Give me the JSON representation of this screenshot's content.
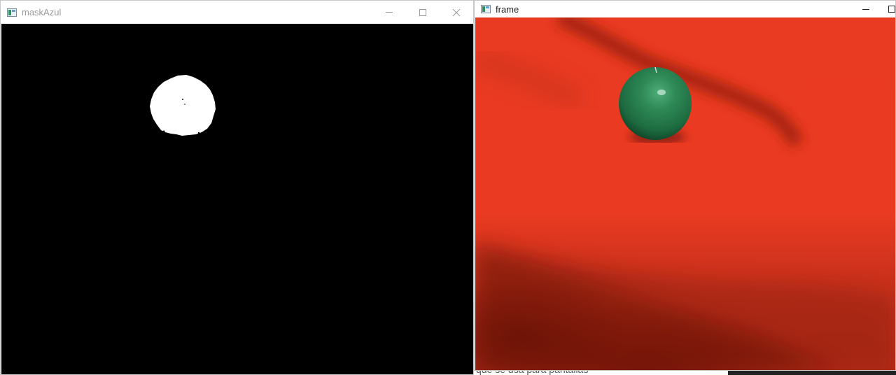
{
  "desktop": {
    "background_text": "que se usa para pantallas"
  },
  "windows": [
    {
      "title": "maskAzul",
      "icon": "opencv-window-icon",
      "controls": [
        "minimize-icon",
        "maximize-icon",
        "close-icon"
      ],
      "state": "inactive"
    },
    {
      "title": "frame",
      "icon": "opencv-window-icon",
      "controls": [
        "minimize-icon",
        "maximize-icon"
      ],
      "state": "active"
    }
  ],
  "colors": {
    "mask_background": "#000000",
    "mask_blob": "#ffffff",
    "frame_background": "#e93a22",
    "ball": "#2f8a57"
  }
}
